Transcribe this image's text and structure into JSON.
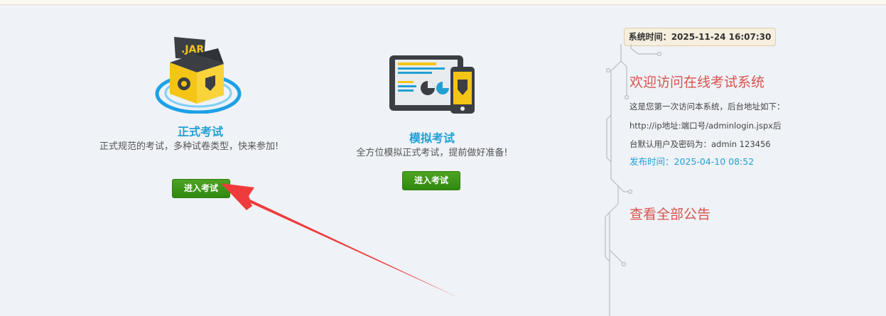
{
  "formal_exam": {
    "title": "正式考试",
    "description": "正式规范的考试，多种试卷类型，快来参加!",
    "button": "进入考试",
    "illustration_label": ".JAR"
  },
  "mock_exam": {
    "title": "模拟考试",
    "description": "全方位模拟正式考试，提前做好准备!",
    "button": "进入考试"
  },
  "system_time": {
    "label": "系统时间：",
    "value": "2025-11-24 16:07:30"
  },
  "notice": {
    "title": "欢迎访问在线考试系统",
    "body": "这是您第一次访问本系统，后台地址如下：http://ip地址:端口号/adminlogin.jspx后台默认用户及密码为：admin 123456",
    "published_label": "发布时间：",
    "published_value": "2025-04-10 08:52"
  },
  "view_all": "查看全部公告",
  "colors": {
    "background": "#eff2f6",
    "title_blue": "#22a0d4",
    "button_green": "#3a9416",
    "notice_red": "#d9534f",
    "annotation_arrow": "#ef3b3b"
  },
  "icons": [
    "jar-box-icon",
    "tablet-phone-icon",
    "circuit-decoration"
  ]
}
